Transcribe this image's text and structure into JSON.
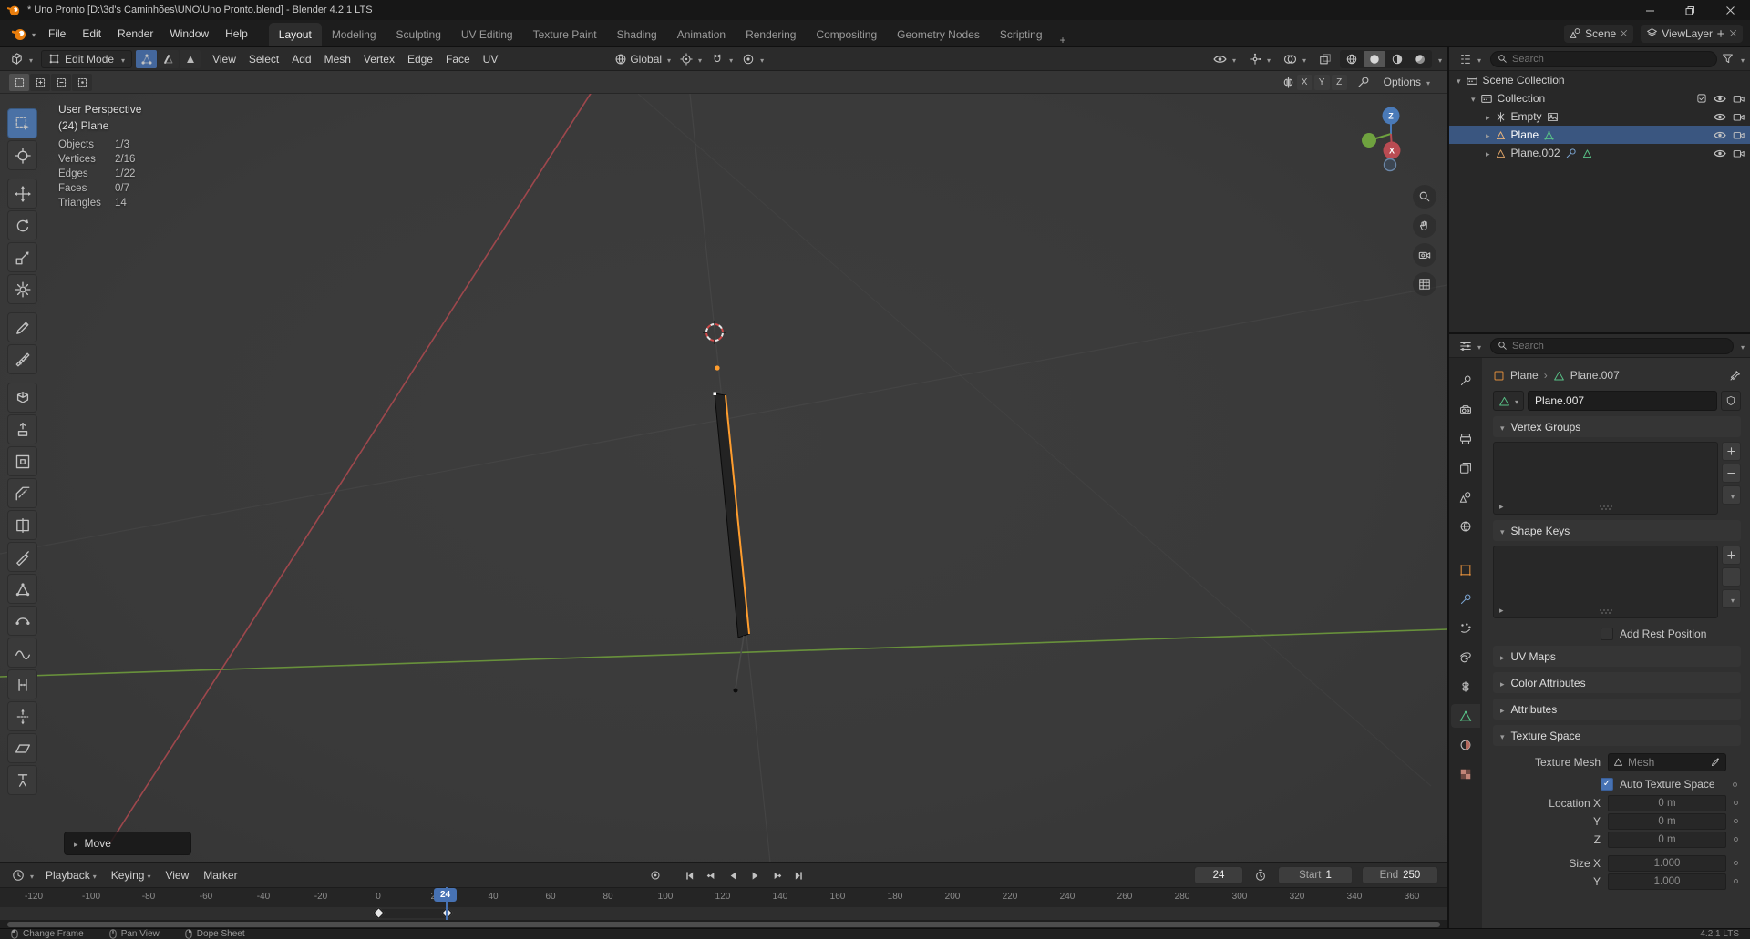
{
  "colors": {
    "accent": "#4772b3",
    "object_outline": "#ff9d2e",
    "axis_x": "#b04a50",
    "axis_y": "#6e9b3c",
    "selection_row": "#3a5680",
    "mesh_data_green": "#58c287",
    "object_orange": "#e08e3c"
  },
  "titlebar": {
    "title": "* Uno Pronto [D:\\3d's Caminhões\\UNO\\Uno Pronto.blend] - Blender 4.2.1 LTS"
  },
  "topbar": {
    "menus": [
      "File",
      "Edit",
      "Render",
      "Window",
      "Help"
    ],
    "workspaces": [
      "Layout",
      "Modeling",
      "Sculpting",
      "UV Editing",
      "Texture Paint",
      "Shading",
      "Animation",
      "Rendering",
      "Compositing",
      "Geometry Nodes",
      "Scripting"
    ],
    "add_workspace": "+",
    "scene": "Scene",
    "view_layer": "ViewLayer"
  },
  "viewport_header": {
    "mode": "Edit Mode",
    "menus": [
      "View",
      "Select",
      "Add",
      "Mesh",
      "Vertex",
      "Edge",
      "Face",
      "UV"
    ],
    "orientation": "Global"
  },
  "tool_settings": {
    "axes": [
      "X",
      "Y",
      "Z"
    ],
    "options": "Options"
  },
  "toolbar": {
    "tools": [
      "select-box",
      "cursor",
      "move",
      "rotate",
      "scale",
      "transform",
      "annotate",
      "measure",
      "add-cube",
      "extrude-region",
      "inset-faces",
      "bevel",
      "loop-cut",
      "knife",
      "poly-build",
      "spin",
      "smooth",
      "edge-slide",
      "shrink-fatten",
      "shear",
      "rip-region"
    ]
  },
  "viewport": {
    "overlay": {
      "view": "User Perspective",
      "object": "(24) Plane",
      "stats": [
        {
          "label": "Objects",
          "value": "1/3"
        },
        {
          "label": "Vertices",
          "value": "2/16"
        },
        {
          "label": "Edges",
          "value": "1/22"
        },
        {
          "label": "Faces",
          "value": "0/7"
        },
        {
          "label": "Triangles",
          "value": "14"
        }
      ]
    },
    "gizmo": {
      "x": "X",
      "z": "Z"
    },
    "operator": "Move"
  },
  "outliner": {
    "search_placeholder": "Search",
    "rows": [
      "Scene Collection",
      "Collection",
      "Empty",
      "Plane",
      "Plane.002"
    ]
  },
  "properties": {
    "search_placeholder": "Search",
    "breadcrumb": {
      "object": "Plane",
      "data": "Plane.007"
    },
    "name_value": "Plane.007",
    "panels": {
      "vertex_groups": "Vertex Groups",
      "shape_keys": "Shape Keys",
      "add_rest_position": "Add Rest Position",
      "uv_maps": "UV Maps",
      "color_attributes": "Color Attributes",
      "attributes": "Attributes",
      "texture_space": "Texture Space"
    },
    "texture_space": {
      "texture_mesh_label": "Texture Mesh",
      "texture_mesh_placeholder": "Mesh",
      "auto_label": "Auto Texture Space",
      "rows": [
        {
          "label": "Location X",
          "value": "0 m"
        },
        {
          "label": "Y",
          "value": "0 m"
        },
        {
          "label": "Z",
          "value": "0 m"
        },
        {
          "label": "Size X",
          "value": "1.000"
        },
        {
          "label": "Y",
          "value": "1.000"
        }
      ]
    }
  },
  "timeline": {
    "menus": [
      "Playback",
      "Keying",
      "View",
      "Marker"
    ],
    "current_frame": "24",
    "badge": "24",
    "start_label": "Start",
    "start_value": "1",
    "end_label": "End",
    "end_value": "250",
    "ticks": [
      "-120",
      "-100",
      "-80",
      "-60",
      "-40",
      "-20",
      "0",
      "20",
      "40",
      "60",
      "80",
      "100",
      "120",
      "140",
      "160",
      "180",
      "200",
      "220",
      "240",
      "260",
      "280",
      "300",
      "320",
      "340",
      "360"
    ]
  },
  "statusbar": {
    "items": [
      "Change Frame",
      "Pan View",
      "Dope Sheet"
    ],
    "version": "4.2.1 LTS"
  }
}
